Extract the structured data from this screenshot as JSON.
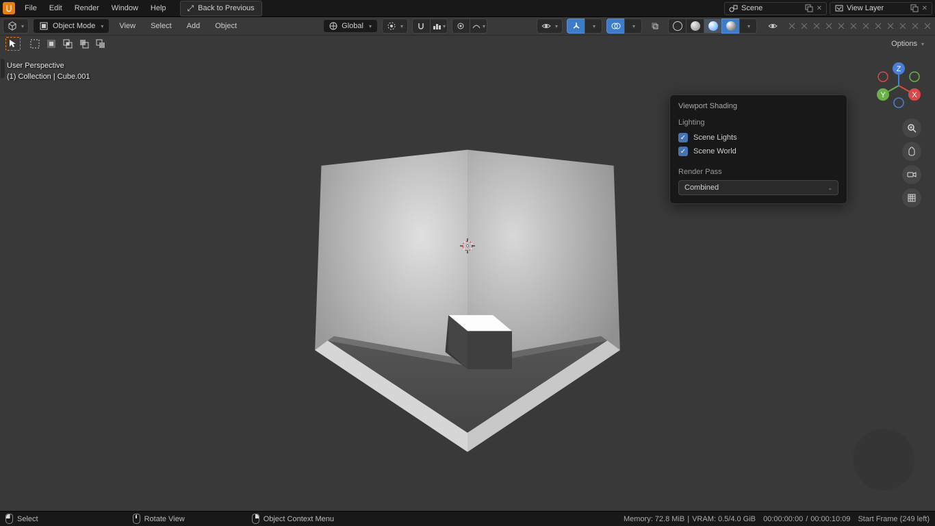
{
  "top_menu": {
    "file": "File",
    "edit": "Edit",
    "render": "Render",
    "window": "Window",
    "help": "Help",
    "back": "Back to Previous"
  },
  "scene_selector": {
    "label": "Scene"
  },
  "layer_selector": {
    "label": "View Layer"
  },
  "header": {
    "mode": "Object Mode",
    "view": "View",
    "select": "Select",
    "add": "Add",
    "object": "Object",
    "orientation": "Global",
    "options": "Options"
  },
  "viewport_label": {
    "line1": "User Perspective",
    "line2": "(1) Collection | Cube.001"
  },
  "popup": {
    "title": "Viewport Shading",
    "lighting_header": "Lighting",
    "scene_lights": "Scene Lights",
    "scene_world": "Scene World",
    "render_pass_header": "Render Pass",
    "render_pass_value": "Combined"
  },
  "gizmo": {
    "x": "X",
    "y": "Y",
    "z": "Z"
  },
  "status": {
    "select": "Select",
    "rotate": "Rotate View",
    "context": "Object Context Menu",
    "memory": "Memory: 72.8 MiB",
    "vram": "VRAM: 0.5/4.0 GiB",
    "time1": "00:00:00:00",
    "time2": "00:00:10:09",
    "frame": "Start Frame (249 left)"
  }
}
